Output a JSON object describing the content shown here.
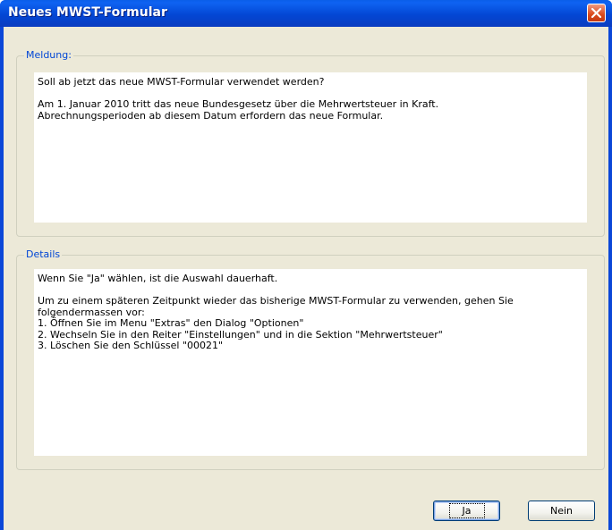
{
  "window": {
    "title": "Neues MWST-Formular"
  },
  "message_group": {
    "legend": "Meldung:",
    "lines": [
      "Soll ab jetzt das neue MWST-Formular verwendet werden?",
      "",
      "Am 1. Januar 2010 tritt das neue Bundesgesetz über die Mehrwertsteuer in Kraft.",
      "Abrechnungsperioden ab diesem Datum erfordern das neue Formular."
    ]
  },
  "details_group": {
    "legend": "Details",
    "lines": [
      "Wenn Sie \"Ja\" wählen, ist die Auswahl dauerhaft.",
      "",
      "Um zu einem späteren Zeitpunkt wieder das bisherige MWST-Formular zu verwenden, gehen Sie",
      "folgendermassen vor:",
      "1. Öffnen Sie im Menu \"Extras\" den Dialog \"Optionen\"",
      "2. Wechseln Sie in den Reiter \"Einstellungen\" und in die Sektion \"Mehrwertsteuer\"",
      "3. Löschen Sie den Schlüssel \"00021\""
    ]
  },
  "buttons": {
    "yes": "Ja",
    "no": "Nein"
  },
  "icons": {
    "close": "close-icon"
  }
}
